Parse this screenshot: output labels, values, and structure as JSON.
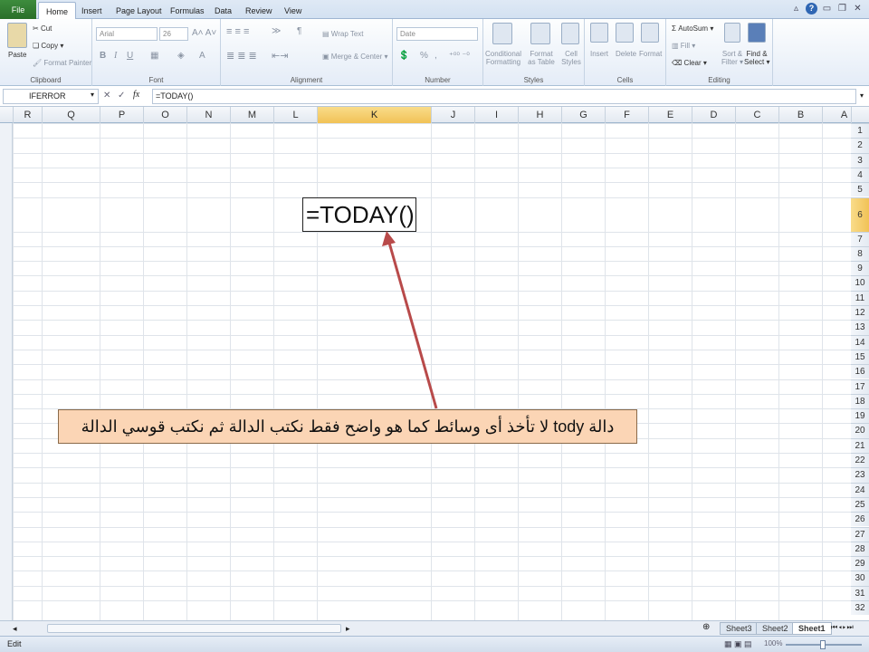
{
  "tabs": {
    "file": "File",
    "home": "Home",
    "insert": "Insert",
    "page_layout": "Page Layout",
    "formulas": "Formulas",
    "data": "Data",
    "review": "Review",
    "view": "View"
  },
  "clipboard": {
    "paste": "Paste",
    "cut": "Cut",
    "copy": "Copy",
    "format_painter": "Format Painter",
    "label": "Clipboard"
  },
  "font": {
    "name": "Arial",
    "size": "26",
    "label": "Font"
  },
  "alignment": {
    "wrap_text": "Wrap Text",
    "merge_center": "Merge & Center",
    "label": "Alignment"
  },
  "number": {
    "format": "Date",
    "label": "Number",
    "percent": "%",
    "comma": ","
  },
  "styles": {
    "conditional": "Conditional",
    "conditional2": "Formatting",
    "format_as": "Format",
    "format_as2": "as Table",
    "cell": "Cell",
    "cell2": "Styles",
    "label": "Styles"
  },
  "cells": {
    "insert": "Insert",
    "delete": "Delete",
    "format": "Format",
    "label": "Cells"
  },
  "editing": {
    "autosum": "AutoSum",
    "fill": "Fill",
    "clear": "Clear",
    "sort": "Sort &",
    "sort2": "Filter",
    "find": "Find &",
    "find2": "Select",
    "label": "Editing"
  },
  "formula_bar": {
    "name_box": "IFERROR",
    "fx": "fx",
    "formula": "=TODAY()"
  },
  "columns": [
    "R",
    "Q",
    "P",
    "O",
    "N",
    "M",
    "L",
    "K",
    "J",
    "I",
    "H",
    "G",
    "F",
    "E",
    "D",
    "C",
    "B",
    "A"
  ],
  "selected_column": "K",
  "rows": [
    "1",
    "2",
    "3",
    "4",
    "5",
    "6",
    "7",
    "8",
    "9",
    "10",
    "11",
    "12",
    "13",
    "14",
    "15",
    "16",
    "17",
    "18",
    "19",
    "20",
    "21",
    "22",
    "23",
    "24",
    "25",
    "26",
    "27",
    "28",
    "29",
    "30",
    "31",
    "32"
  ],
  "selected_row": "6",
  "cell_content": "=TODAY()",
  "callout_text": "دالة tody لا تأخذ أى وسائط كما هو واضح فقط نكتب الدالة ثم نكتب قوسي الدالة",
  "sheets": [
    "Sheet3",
    "Sheet2",
    "Sheet1"
  ],
  "active_sheet": "Sheet1",
  "status": {
    "mode": "Edit",
    "zoom": "100%"
  },
  "colors": {
    "accent": "#f1c256",
    "arrow": "#b84a4a",
    "callout_bg": "#fbd5b5",
    "file_tab": "#2a6f2a"
  }
}
